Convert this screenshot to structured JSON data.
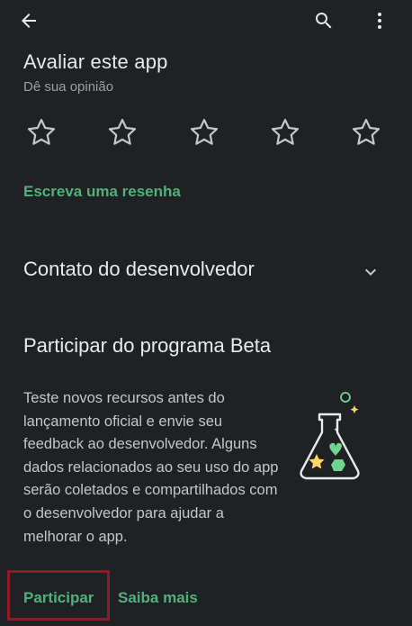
{
  "top_bar": {
    "icons": [
      "back-arrow-icon",
      "search-icon",
      "more-vert-icon"
    ]
  },
  "rate": {
    "title": "Avaliar este app",
    "subtitle": "Dê sua opinião",
    "stars": 5,
    "write_review": "Escreva uma resenha"
  },
  "developer_contact": {
    "label": "Contato do desenvolvedor"
  },
  "beta": {
    "title": "Participar do programa Beta",
    "description": "Teste novos recursos antes do lançamento oficial e envie seu feedback ao desenvolvedor. Alguns dados relacionados ao seu uso do app serão coletados e compartilhados com o desenvolvedor para ajudar a melhorar o app.",
    "join_label": "Participar",
    "learn_more_label": "Saiba mais"
  },
  "colors": {
    "background": "#202124",
    "accent_green": "#4fb27e",
    "text_primary": "#e8eaed",
    "text_secondary": "#9aa0a6",
    "highlight_border": "#8e1b25"
  }
}
